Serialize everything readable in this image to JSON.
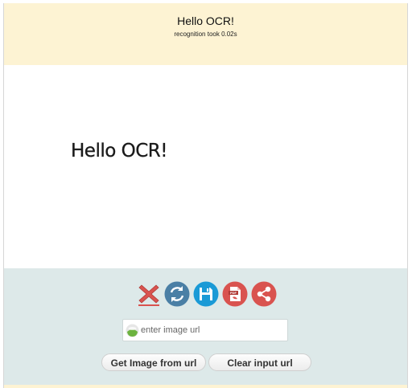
{
  "header": {
    "title": "Hello OCR!",
    "subtitle": "recognition took 0.02s"
  },
  "canvas": {
    "recognized_text": "Hello OCR!"
  },
  "toolbar": {
    "icons": [
      {
        "name": "delete-icon",
        "color": "#d9534f"
      },
      {
        "name": "refresh-icon",
        "color": "#4a7fa5"
      },
      {
        "name": "save-icon",
        "color": "#1a9ad6"
      },
      {
        "name": "pdf-icon",
        "color": "#d9534f"
      },
      {
        "name": "share-icon",
        "color": "#d9534f"
      }
    ]
  },
  "url_input": {
    "placeholder": "enter image url",
    "value": ""
  },
  "buttons": {
    "get_image": "Get Image from url",
    "clear_input": "Clear input url"
  },
  "colors": {
    "header_bg": "#fdf3d3",
    "toolbar_bg": "#dde9e9"
  }
}
